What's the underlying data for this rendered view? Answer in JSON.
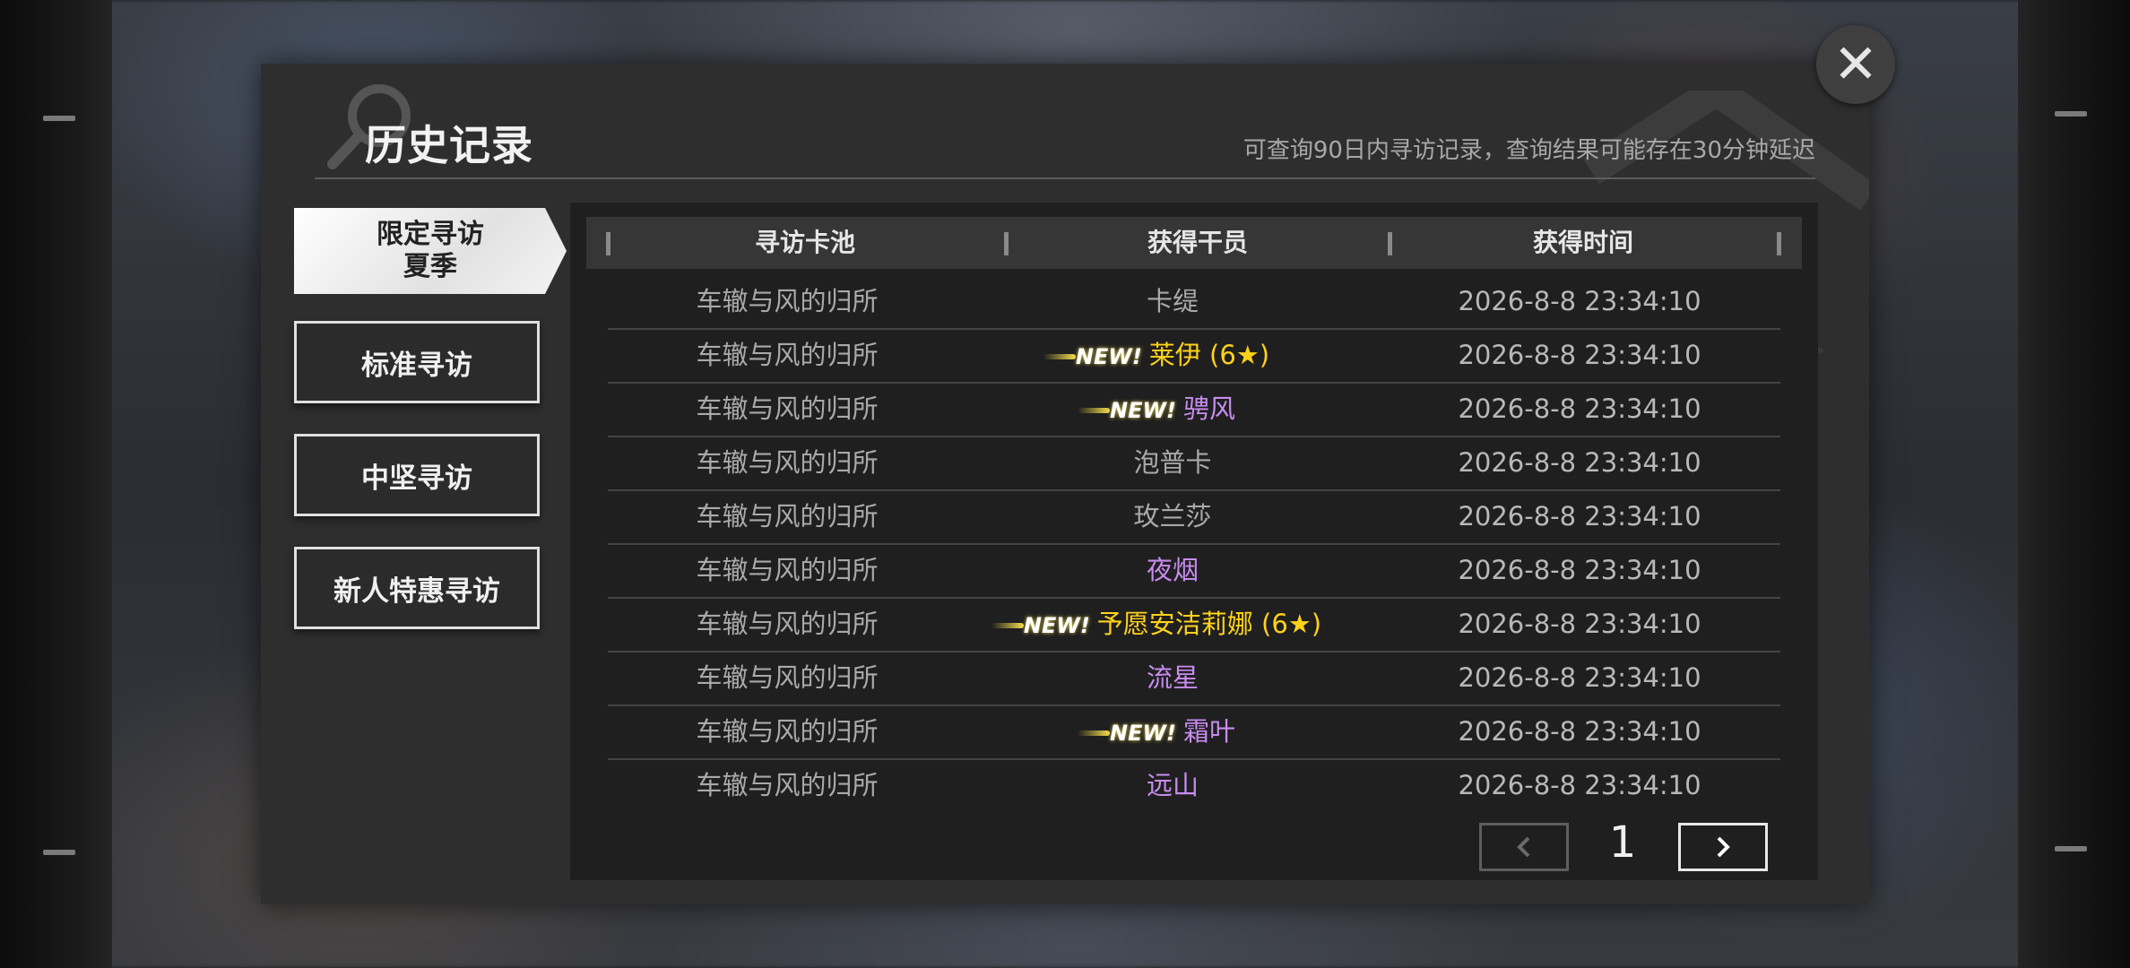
{
  "dialog": {
    "title": "历史记录",
    "hint": "可查询90日内寻访记录，查询结果可能存在30分钟延迟",
    "close_icon": "close-icon"
  },
  "tabs": [
    {
      "label_line1": "限定寻访",
      "label_line2": "夏季",
      "active": true
    },
    {
      "label": "标准寻访",
      "active": false
    },
    {
      "label": "中坚寻访",
      "active": false
    },
    {
      "label": "新人特惠寻访",
      "active": false
    }
  ],
  "table": {
    "headers": [
      "寻访卡池",
      "获得干员",
      "获得时间"
    ],
    "new_label": "NEW!",
    "rows": [
      {
        "pool": "车辙与风的归所",
        "operator": "卡缇",
        "rarity_color": "grey",
        "is_new": false,
        "time": "2026-8-8 23:34:10"
      },
      {
        "pool": "车辙与风的归所",
        "operator": "莱伊 (6★)",
        "rarity_color": "gold",
        "is_new": true,
        "time": "2026-8-8 23:34:10"
      },
      {
        "pool": "车辙与风的归所",
        "operator": "骋风",
        "rarity_color": "purple",
        "is_new": true,
        "time": "2026-8-8 23:34:10"
      },
      {
        "pool": "车辙与风的归所",
        "operator": "泡普卡",
        "rarity_color": "grey",
        "is_new": false,
        "time": "2026-8-8 23:34:10"
      },
      {
        "pool": "车辙与风的归所",
        "operator": "玫兰莎",
        "rarity_color": "grey",
        "is_new": false,
        "time": "2026-8-8 23:34:10"
      },
      {
        "pool": "车辙与风的归所",
        "operator": "夜烟",
        "rarity_color": "purple",
        "is_new": false,
        "time": "2026-8-8 23:34:10"
      },
      {
        "pool": "车辙与风的归所",
        "operator": "予愿安洁莉娜 (6★)",
        "rarity_color": "gold",
        "is_new": true,
        "time": "2026-8-8 23:34:10"
      },
      {
        "pool": "车辙与风的归所",
        "operator": "流星",
        "rarity_color": "purple",
        "is_new": false,
        "time": "2026-8-8 23:34:10"
      },
      {
        "pool": "车辙与风的归所",
        "operator": "霜叶",
        "rarity_color": "purple",
        "is_new": true,
        "time": "2026-8-8 23:34:10"
      },
      {
        "pool": "车辙与风的归所",
        "operator": "远山",
        "rarity_color": "purple",
        "is_new": false,
        "time": "2026-8-8 23:34:10"
      }
    ]
  },
  "pagination": {
    "current_page": "1",
    "prev_icon": "chevron-left-icon",
    "next_icon": "chevron-right-icon"
  },
  "colors": {
    "gold": "#ffd21a",
    "purple": "#c88cf0",
    "grey": "#a9a9a9"
  }
}
